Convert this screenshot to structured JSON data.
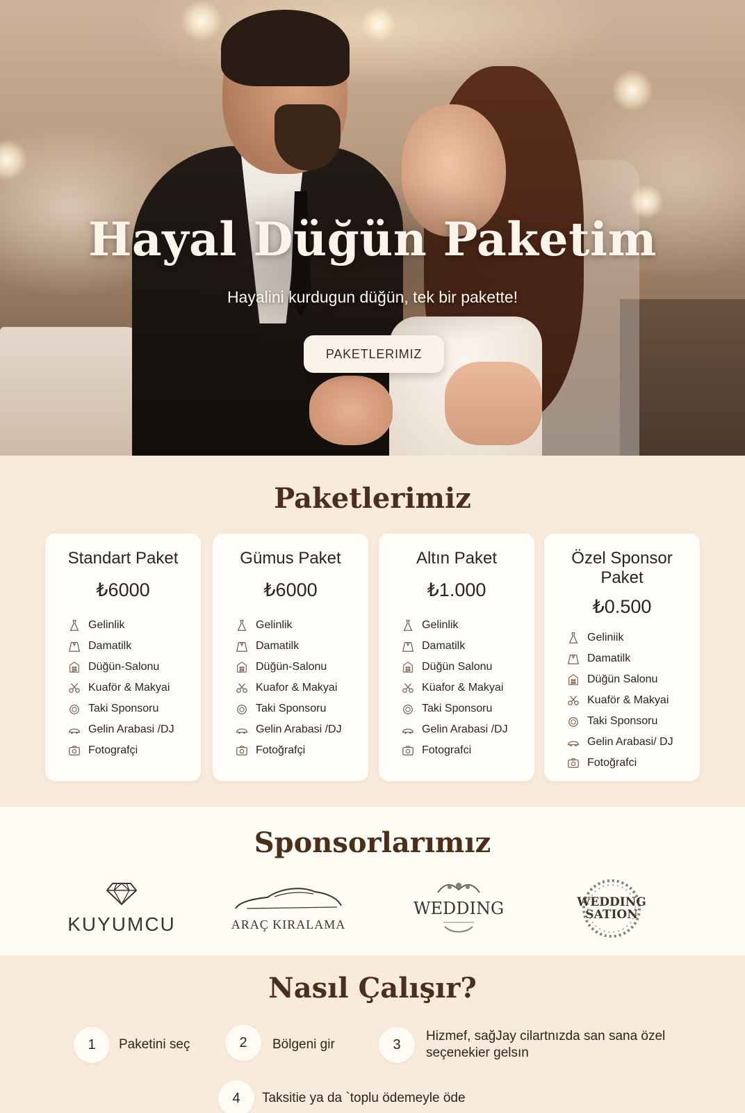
{
  "hero": {
    "title": "Hayal Düğün Paketim",
    "subtitle": "Hayalini kurdugun düğün, tek bir pakette!",
    "cta_label": "PAKETLERIMIZ"
  },
  "packages": {
    "title": "Paketlerimiz",
    "cards": [
      {
        "name": "Standart Paket",
        "price": "₺6000",
        "features": [
          {
            "icon": "dress-icon",
            "label": "Gelinlik"
          },
          {
            "icon": "suit-icon",
            "label": "Damatilk"
          },
          {
            "icon": "building-icon",
            "label": "Düğün-Salonu"
          },
          {
            "icon": "scissors-icon",
            "label": "Kuaför & Makyai"
          },
          {
            "icon": "ring-icon",
            "label": "Taki Sponsoru"
          },
          {
            "icon": "car-icon",
            "label": "Gelin Arabasi /DJ"
          },
          {
            "icon": "camera-icon",
            "label": "Fotografçi"
          }
        ]
      },
      {
        "name": "Gümus Paket",
        "price": "₺6000",
        "features": [
          {
            "icon": "dress-icon",
            "label": "Gelinlik"
          },
          {
            "icon": "suit-icon",
            "label": "Damatilk"
          },
          {
            "icon": "building-icon",
            "label": "Düğün-Salonu"
          },
          {
            "icon": "scissors-icon",
            "label": "Kuafor & Makyai"
          },
          {
            "icon": "ring-icon",
            "label": "Taki Sponsoru"
          },
          {
            "icon": "car-icon",
            "label": "Gelin Arabasi /DJ"
          },
          {
            "icon": "camera-icon",
            "label": "Fotoğrafçi"
          }
        ]
      },
      {
        "name": "Altın Paket",
        "price": "₺1.000",
        "features": [
          {
            "icon": "dress-icon",
            "label": "Gelinlik"
          },
          {
            "icon": "suit-icon",
            "label": "Damatilk"
          },
          {
            "icon": "building-icon",
            "label": "Düğün Salonu"
          },
          {
            "icon": "scissors-icon",
            "label": "Küafor & Makyai"
          },
          {
            "icon": "ring-icon",
            "label": "Taki Sponsoru"
          },
          {
            "icon": "car-icon",
            "label": "Gelin Arabasi /DJ"
          },
          {
            "icon": "camera-icon",
            "label": "Fotografci"
          }
        ]
      },
      {
        "name": "Özel Sponsor Paket",
        "price": "₺0.500",
        "features": [
          {
            "icon": "dress-icon",
            "label": "Geliniik"
          },
          {
            "icon": "suit-icon",
            "label": "Damatilk"
          },
          {
            "icon": "building-icon",
            "label": "Düğün Salonu"
          },
          {
            "icon": "scissors-icon",
            "label": "Kuaför & Makyai"
          },
          {
            "icon": "ring-icon",
            "label": "Taki Sponsoru"
          },
          {
            "icon": "car-icon",
            "label": "Gelin Arabasi/ DJ"
          },
          {
            "icon": "camera-icon",
            "label": "Fotoğrafci"
          }
        ]
      }
    ]
  },
  "sponsors": {
    "title": "Sponsorlarımız",
    "items": [
      {
        "name": "KUYUMCU",
        "icon": "diamond-icon"
      },
      {
        "name": "ARAÇ KIRALAMA",
        "icon": "car-icon"
      },
      {
        "name": "WEDDING",
        "icon": "floral-icon"
      },
      {
        "name_line1": "WEDDING",
        "name_line2": "SATION",
        "icon": "wreath-icon"
      }
    ]
  },
  "how": {
    "title": "Nasıl Çalışır?",
    "steps": [
      {
        "num": "1",
        "text": "Paketini seç"
      },
      {
        "num": "2",
        "text": "Bölgeni gir"
      },
      {
        "num": "3",
        "text": "Hizmef, sağJay cilartnızda san sana özel seçenekier gelsın"
      },
      {
        "num": "4",
        "text": "Taksitie ya da `toplu ödemeyle öde"
      }
    ]
  },
  "colors": {
    "accent": "#4a2f1c",
    "page_bg": "#f9ebdc",
    "card_bg": "#fffdfa",
    "button_bg": "#fbf3ea"
  }
}
